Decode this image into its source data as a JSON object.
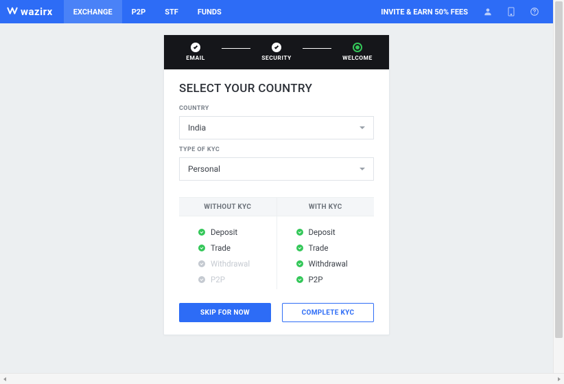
{
  "brand": {
    "name": "wazirx"
  },
  "nav": {
    "items": [
      "EXCHANGE",
      "P2P",
      "STF",
      "FUNDS"
    ],
    "invite": "INVITE & EARN 50% FEES"
  },
  "steps": {
    "items": [
      {
        "label": "EMAIL",
        "state": "done"
      },
      {
        "label": "SECURITY",
        "state": "done"
      },
      {
        "label": "WELCOME",
        "state": "active"
      }
    ]
  },
  "title": "SELECT YOUR COUNTRY",
  "fields": {
    "country_label": "COUNTRY",
    "country_value": "India",
    "kyc_type_label": "TYPE OF KYC",
    "kyc_type_value": "Personal"
  },
  "kyc": {
    "without_header": "WITHOUT KYC",
    "with_header": "WITH KYC",
    "without": [
      {
        "label": "Deposit",
        "enabled": true
      },
      {
        "label": "Trade",
        "enabled": true
      },
      {
        "label": "Withdrawal",
        "enabled": false
      },
      {
        "label": "P2P",
        "enabled": false
      }
    ],
    "with": [
      {
        "label": "Deposit",
        "enabled": true
      },
      {
        "label": "Trade",
        "enabled": true
      },
      {
        "label": "Withdrawal",
        "enabled": true
      },
      {
        "label": "P2P",
        "enabled": true
      }
    ]
  },
  "buttons": {
    "skip": "SKIP FOR NOW",
    "complete": "COMPLETE KYC"
  }
}
